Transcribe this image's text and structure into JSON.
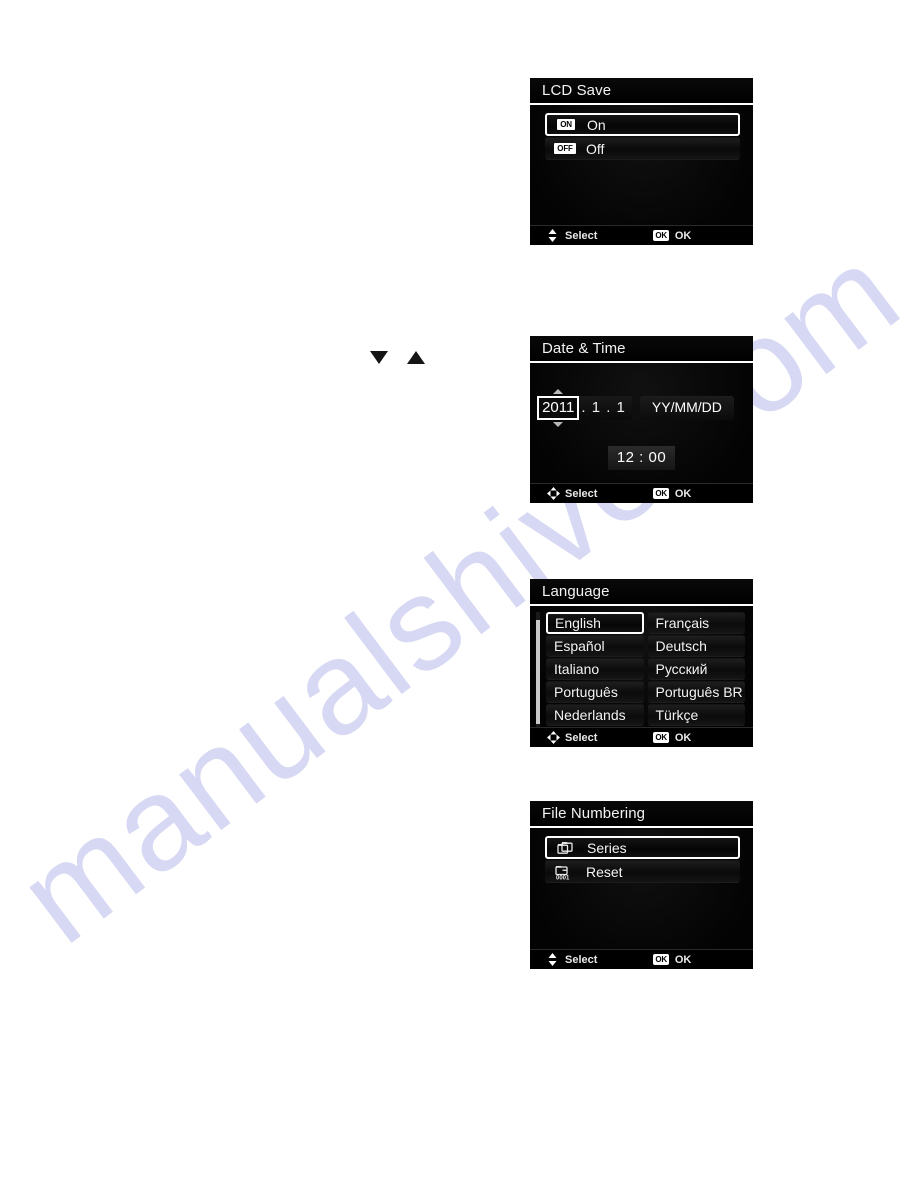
{
  "page": {
    "watermark_text": "manualshive.com",
    "watermark_color": "#9ea0e2",
    "background_color": "#ffffff"
  },
  "body_glyphs": {
    "down_triangle": "down-triangle",
    "up_triangle": "up-triangle"
  },
  "screens": [
    {
      "id": "lcd-save",
      "title": "LCD Save",
      "type": "option-list",
      "options": [
        {
          "badge": "ON",
          "label": "On",
          "selected": true
        },
        {
          "badge": "OFF",
          "label": "Off",
          "selected": false
        }
      ],
      "footer": {
        "nav_icon": "up-down-arrow-icon",
        "nav_label": "Select",
        "ok_badge": "OK",
        "ok_label": "OK"
      }
    },
    {
      "id": "date-time",
      "title": "Date & Time",
      "type": "date-time",
      "date": {
        "year": "2011",
        "rest": ". 1 . 1",
        "format": "YY/MM/DD",
        "spinner_up": "chevron-up-icon",
        "spinner_down": "chevron-down-icon"
      },
      "time": "12 : 00",
      "footer": {
        "nav_icon": "four-way-arrow-icon",
        "nav_label": "Select",
        "ok_badge": "OK",
        "ok_label": "OK"
      }
    },
    {
      "id": "language",
      "title": "Language",
      "type": "language-grid",
      "languages": [
        {
          "label": "English",
          "selected": true
        },
        {
          "label": "Français",
          "selected": false
        },
        {
          "label": "Español",
          "selected": false
        },
        {
          "label": "Deutsch",
          "selected": false
        },
        {
          "label": "Italiano",
          "selected": false
        },
        {
          "label": "Русский",
          "selected": false
        },
        {
          "label": "Português",
          "selected": false
        },
        {
          "label": "Português BR",
          "selected": false
        },
        {
          "label": "Nederlands",
          "selected": false
        },
        {
          "label": "Türkçe",
          "selected": false
        }
      ],
      "footer": {
        "nav_icon": "four-way-arrow-icon",
        "nav_label": "Select",
        "ok_badge": "OK",
        "ok_label": "OK"
      }
    },
    {
      "id": "file-numbering",
      "title": "File Numbering",
      "type": "option-list",
      "options": [
        {
          "icon": "stacked-folders-icon",
          "label": "Series",
          "selected": true
        },
        {
          "icon": "folder-reset-0001-icon",
          "label": "Reset",
          "selected": false
        }
      ],
      "footer": {
        "nav_icon": "up-down-arrow-icon",
        "nav_label": "Select",
        "ok_badge": "OK",
        "ok_label": "OK"
      }
    }
  ]
}
